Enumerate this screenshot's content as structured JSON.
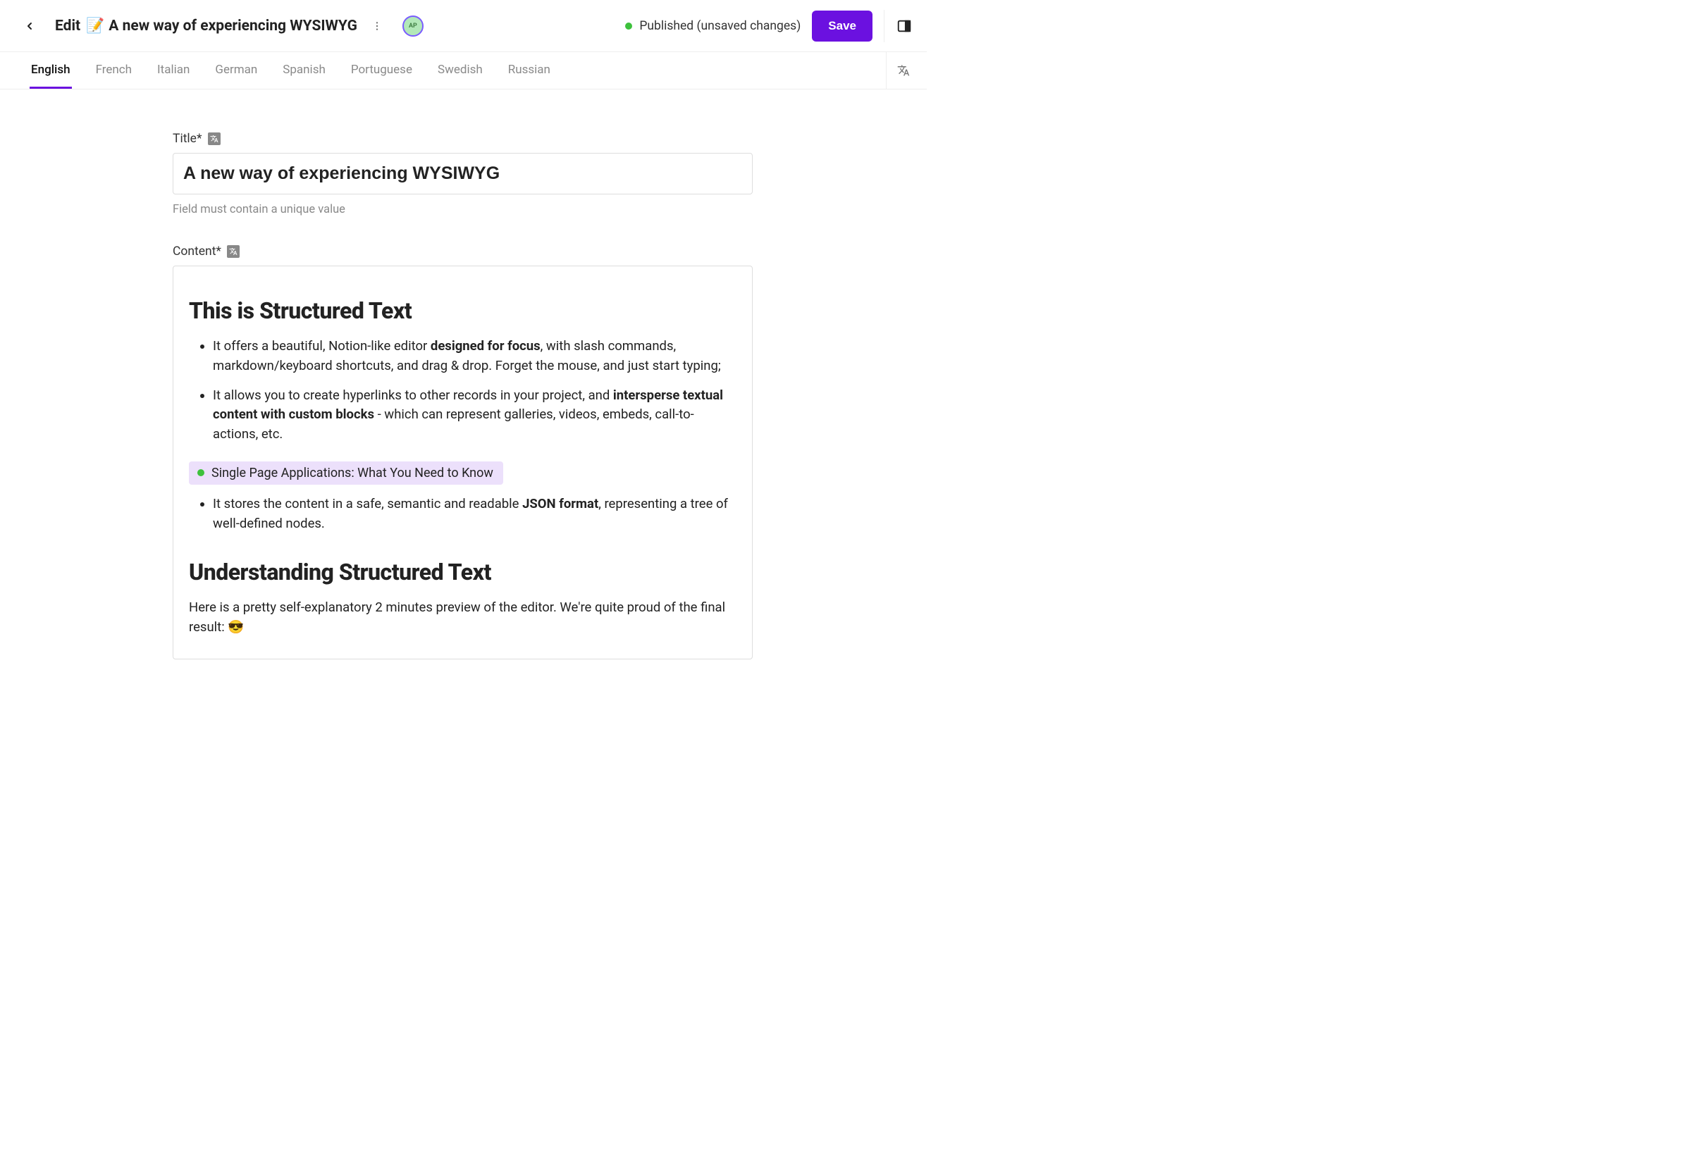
{
  "header": {
    "title_prefix": "Edit",
    "title_emoji": "📝",
    "title_text": "A new way of experiencing WYSIWYG",
    "avatar_initials": "AP",
    "status_text": "Published (unsaved changes)",
    "save_label": "Save"
  },
  "tabs": [
    "English",
    "French",
    "Italian",
    "German",
    "Spanish",
    "Portuguese",
    "Swedish",
    "Russian"
  ],
  "active_tab_index": 0,
  "fields": {
    "title": {
      "label": "Title*",
      "value": "A new way of experiencing WYSIWYG",
      "hint": "Field must contain a unique value"
    },
    "content": {
      "label": "Content*"
    }
  },
  "editor": {
    "h2_1": "This is Structured Text",
    "li1_a": "It offers a beautiful, Notion-like editor ",
    "li1_b": "designed for focus",
    "li1_c": ", with slash commands, markdown/keyboard shortcuts, and drag & drop. Forget the mouse, and just start typing;",
    "li2_a": "It allows you to create hyperlinks to other records in your project, and ",
    "li2_b": "intersperse textual content with custom blocks",
    "li2_c": " - which can represent galleries, videos, embeds, call-to-actions, etc.",
    "link_chip": "Single Page Applications: What You Need to Know",
    "li3_a": "It stores the content in a safe, semantic and readable ",
    "li3_b": "JSON format",
    "li3_c": ", representing a tree of well-defined nodes.",
    "h2_2": "Understanding Structured Text",
    "p2": "Here is a pretty self-explanatory 2 minutes preview of the editor. We're quite proud of the final result: 😎"
  }
}
